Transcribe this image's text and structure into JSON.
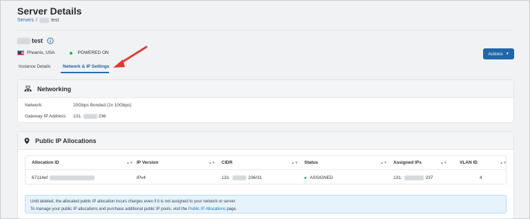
{
  "page": {
    "title": "Server Details"
  },
  "breadcrumb": {
    "servers": "Servers",
    "sep": "/",
    "server_suffix": "test"
  },
  "server": {
    "name_suffix": "test",
    "location": "Phoenix, USA",
    "power_status": "POWERED ON"
  },
  "tabs": [
    {
      "label": "Instance Details",
      "active": false
    },
    {
      "label": "Network & IP Settings",
      "active": true
    }
  ],
  "actions": {
    "label": "Actions"
  },
  "networking": {
    "title": "Networking",
    "network_label": "Network:",
    "network_value": "20Gbps Bonded (2x 10Gbps)",
    "gateway_label": "Gateway IP Address:",
    "gateway_prefix": "131.",
    "gateway_suffix": "236"
  },
  "public_ip": {
    "title": "Public IP Allocations",
    "headers": [
      "Allocation ID",
      "IP Version",
      "CIDR",
      "Status",
      "Assigned IPs",
      "VLAN ID"
    ],
    "row": {
      "allocation_prefix": "67114ef",
      "ip_version": "IPv4",
      "cidr_prefix": "131.",
      "cidr_suffix": "236/31",
      "status": "ASSIGNED",
      "assigned_prefix": "131.",
      "assigned_suffix": "237",
      "vlan": "4"
    },
    "notice_line1": "Until deleted, the allocated public IP allocation incurs charges even if it is not assigned to your network or server.",
    "notice_line2_pre": "To manage your public IP allocations and purchase additional public IP pools, visit the ",
    "notice_link": "Public IP Allocations",
    "notice_line2_post": " page."
  },
  "colors": {
    "accent": "#1e6fb5",
    "button": "#1f67a8",
    "status_green": "#22b14c",
    "arrow": "#e03a32"
  }
}
